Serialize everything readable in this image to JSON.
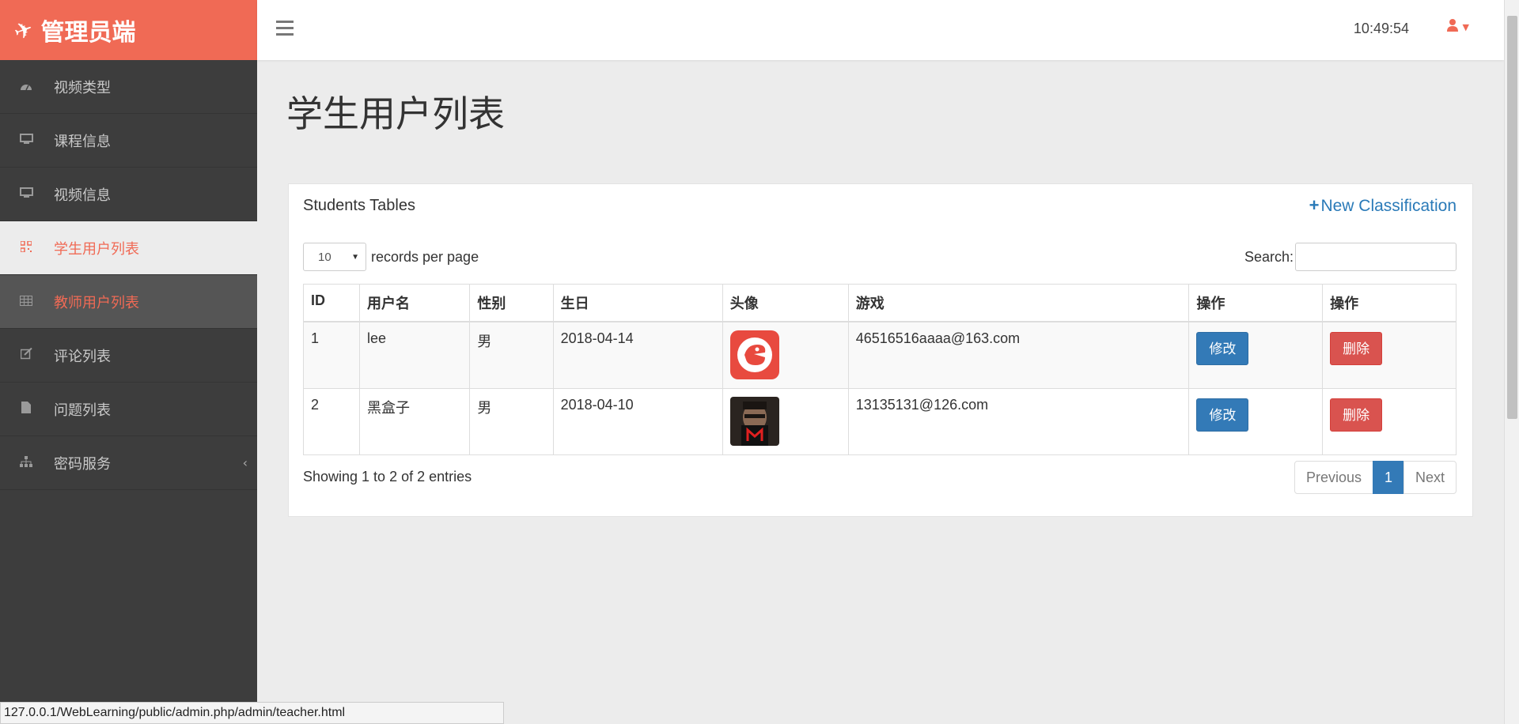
{
  "brand": {
    "title": "管理员端",
    "icon": "plane-icon"
  },
  "sidebar": {
    "items": [
      {
        "label": "视频类型",
        "icon": "dashboard-icon"
      },
      {
        "label": "课程信息",
        "icon": "monitor-icon"
      },
      {
        "label": "视频信息",
        "icon": "monitor-icon"
      },
      {
        "label": "学生用户列表",
        "icon": "qrcode-icon",
        "state": "active"
      },
      {
        "label": "教师用户列表",
        "icon": "table-icon",
        "state": "hover"
      },
      {
        "label": "评论列表",
        "icon": "edit-icon"
      },
      {
        "label": "问题列表",
        "icon": "file-icon"
      },
      {
        "label": "密码服务",
        "icon": "sitemap-icon",
        "has_submenu": true
      }
    ]
  },
  "header": {
    "clock": "10:49:54",
    "user_icon": "user-icon"
  },
  "page": {
    "title": "学生用户列表"
  },
  "panel": {
    "title": "Students Tables",
    "new_button": "New Classification",
    "length_value": "10",
    "length_suffix": "records per page",
    "search_label": "Search:",
    "search_value": "",
    "columns": [
      "ID",
      "用户名",
      "性别",
      "生日",
      "头像",
      "游戏",
      "操作",
      "操作"
    ],
    "rows": [
      {
        "id": "1",
        "username": "lee",
        "gender": "男",
        "birthday": "2018-04-14",
        "avatar": "red-logo-avatar",
        "email": "46516516aaaa@163.com",
        "edit": "修改",
        "delete": "删除"
      },
      {
        "id": "2",
        "username": "黑盒子",
        "gender": "男",
        "birthday": "2018-04-10",
        "avatar": "photo-avatar",
        "email": "13135131@126.com",
        "edit": "修改",
        "delete": "删除"
      }
    ],
    "info": "Showing 1 to 2 of 2 entries",
    "pager": {
      "prev": "Previous",
      "current": "1",
      "next": "Next"
    }
  },
  "statusbar": {
    "url": "127.0.0.1/WebLearning/public/admin.php/admin/teacher.html"
  },
  "colors": {
    "brand": "#f06a55",
    "sidebar": "#3d3d3d",
    "primary": "#337ab7",
    "danger": "#d9534f"
  }
}
